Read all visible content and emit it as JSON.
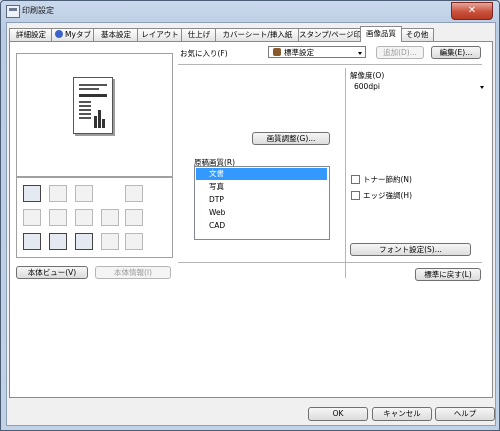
{
  "window": {
    "title": "印刷設定",
    "close_glyph": "✕"
  },
  "tabs": [
    {
      "label": "詳細設定"
    },
    {
      "label": "Myタブ"
    },
    {
      "label": "基本設定"
    },
    {
      "label": "レイアウト"
    },
    {
      "label": "仕上げ"
    },
    {
      "label": "カバーシート/挿入紙"
    },
    {
      "label": "スタンプ/ページ印字"
    },
    {
      "label": "画像品質",
      "active": true
    },
    {
      "label": "その他"
    }
  ],
  "favorites": {
    "label": "お気に入り(F)",
    "value": "標準設定",
    "add_label": "追加(D)...",
    "edit_label": "編集(E)..."
  },
  "image_adjust_label": "画質調整(G)...",
  "original_quality": {
    "label": "原稿画質(R)",
    "options": [
      "文書",
      "写真",
      "DTP",
      "Web",
      "CAD"
    ],
    "selected": "文書"
  },
  "resolution": {
    "label": "解像度(O)",
    "value": "600dpi"
  },
  "toner_save_label": "トナー節約(N)",
  "edge_enhance_label": "エッジ強調(H)",
  "font_settings_label": "フォント設定(S)...",
  "printer_view_label": "本体ビュー(V)",
  "printer_info_label": "本体情報(I)",
  "restore_defaults_label": "標準に戻す(L)",
  "footer": {
    "ok_label": "OK",
    "cancel_label": "キャンセル",
    "help_label": "ヘルプ"
  }
}
